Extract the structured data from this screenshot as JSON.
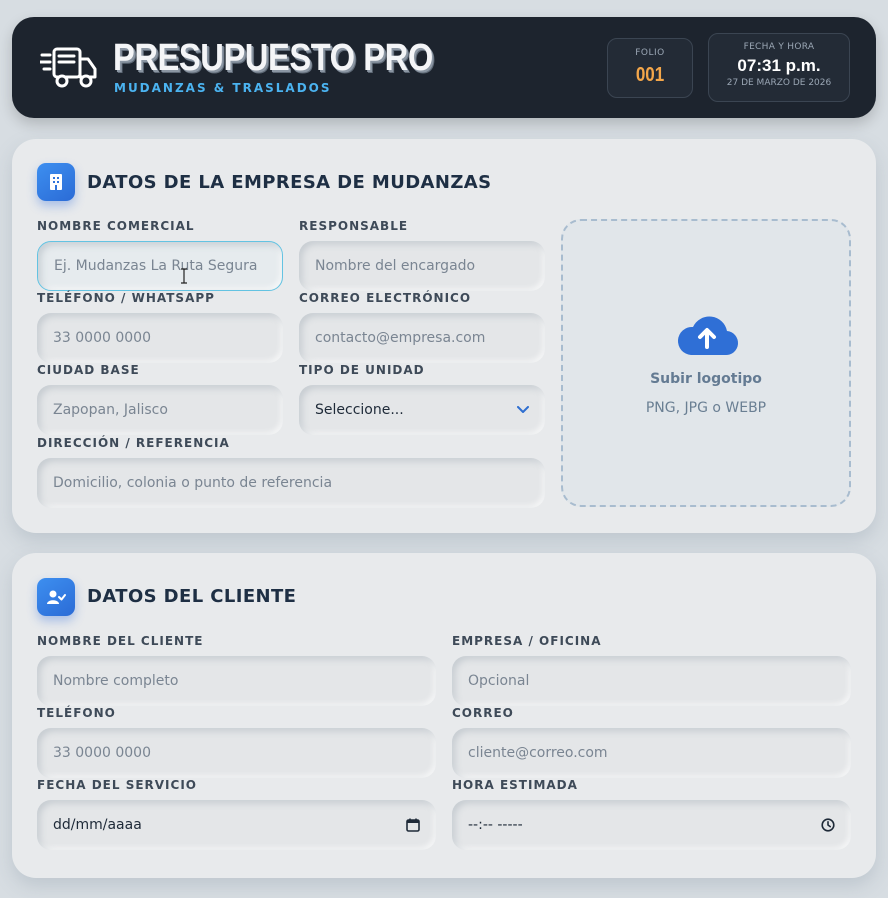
{
  "header": {
    "brand_title": "PRESUPUESTO PRO",
    "brand_subtitle": "MUDANZAS & TRASLADOS",
    "folio_label": "FOLIO",
    "folio_number": "001",
    "datetime_label": "FECHA Y HORA",
    "time": "07:31 p.m.",
    "date": "27 DE MARZO DE 2026",
    "logo_icon": "moving-truck-icon",
    "accent_color": "#4bb3f0",
    "folio_color": "#f3a64a"
  },
  "company": {
    "section_title": "DATOS DE LA EMPRESA DE MUDANZAS",
    "section_icon": "building-icon",
    "fields": {
      "nombre_comercial": {
        "label": "NOMBRE COMERCIAL",
        "placeholder": "Ej. Mudanzas La Ruta Segura"
      },
      "responsable": {
        "label": "RESPONSABLE",
        "placeholder": "Nombre del encargado"
      },
      "telefono": {
        "label": "TELÉFONO / WHATSAPP",
        "placeholder": "33 0000 0000"
      },
      "correo": {
        "label": "CORREO ELECTRÓNICO",
        "placeholder": "contacto@empresa.com"
      },
      "ciudad": {
        "label": "CIUDAD BASE",
        "placeholder": "Zapopan, Jalisco"
      },
      "tipo_unidad": {
        "label": "TIPO DE UNIDAD",
        "selected": "Seleccione..."
      },
      "direccion": {
        "label": "DIRECCIÓN / REFERENCIA",
        "placeholder": "Domicilio, colonia o punto de referencia"
      }
    },
    "upload": {
      "title": "Subir logotipo",
      "formats": "PNG, JPG o WEBP",
      "icon": "cloud-upload-icon"
    }
  },
  "client": {
    "section_title": "DATOS DEL CLIENTE",
    "section_icon": "user-check-icon",
    "fields": {
      "nombre": {
        "label": "NOMBRE DEL CLIENTE",
        "placeholder": "Nombre completo"
      },
      "empresa": {
        "label": "EMPRESA / OFICINA",
        "placeholder": "Opcional"
      },
      "telefono": {
        "label": "TELÉFONO",
        "placeholder": "33 0000 0000"
      },
      "correo": {
        "label": "CORREO",
        "placeholder": "cliente@correo.com"
      },
      "fecha": {
        "label": "FECHA DEL SERVICIO",
        "value": "dd/mm/aaaa"
      },
      "hora": {
        "label": "HORA ESTIMADA",
        "value": "--:-- -----"
      }
    }
  }
}
